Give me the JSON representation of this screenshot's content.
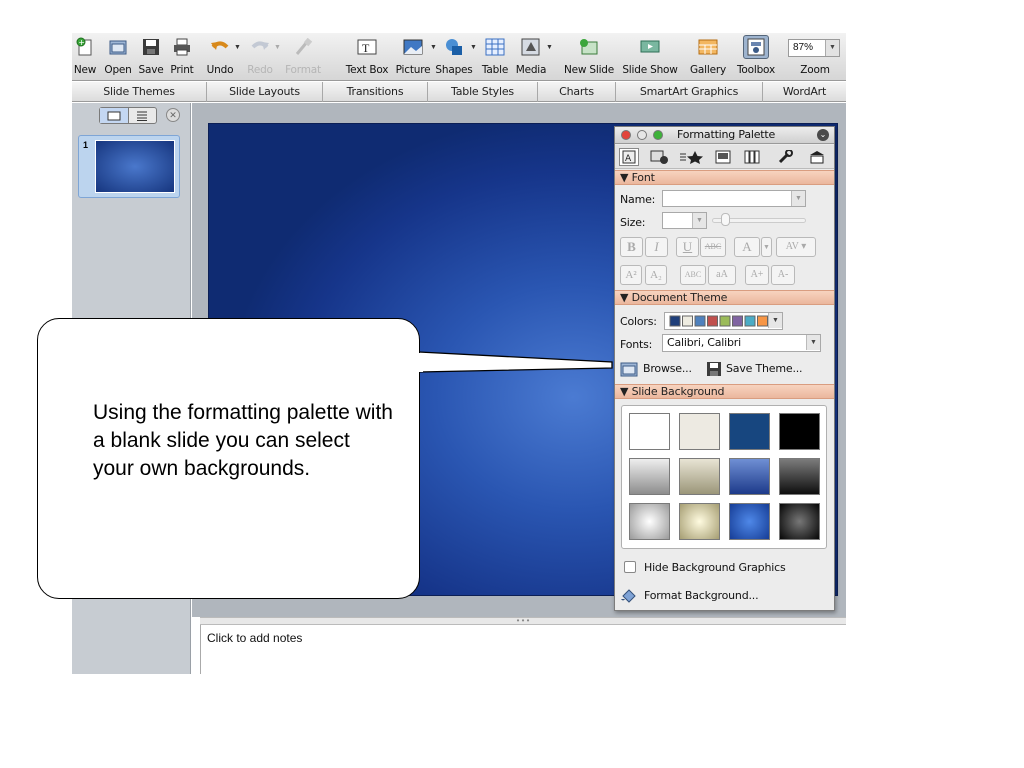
{
  "toolbar": {
    "buttons": [
      {
        "label": "New",
        "icon": "new-presentation-icon"
      },
      {
        "label": "Open",
        "icon": "open-icon"
      },
      {
        "label": "Save",
        "icon": "save-icon"
      },
      {
        "label": "Print",
        "icon": "print-icon"
      },
      {
        "label": "Undo",
        "icon": "undo-icon"
      },
      {
        "label": "Redo",
        "icon": "redo-icon",
        "disabled": true
      },
      {
        "label": "Format",
        "icon": "format-painter-icon",
        "disabled": true
      },
      {
        "label": "Text Box",
        "icon": "text-box-icon"
      },
      {
        "label": "Picture",
        "icon": "picture-icon"
      },
      {
        "label": "Shapes",
        "icon": "shapes-icon"
      },
      {
        "label": "Table",
        "icon": "table-icon"
      },
      {
        "label": "Media",
        "icon": "media-icon"
      },
      {
        "label": "New Slide",
        "icon": "new-slide-icon"
      },
      {
        "label": "Slide Show",
        "icon": "slide-show-icon"
      },
      {
        "label": "Gallery",
        "icon": "gallery-icon"
      },
      {
        "label": "Toolbox",
        "icon": "toolbox-icon"
      },
      {
        "label": "Zoom",
        "icon": "zoom-icon"
      }
    ],
    "zoom_value": "87%"
  },
  "ribbon": {
    "tabs": [
      "Slide Themes",
      "Slide Layouts",
      "Transitions",
      "Table Styles",
      "Charts",
      "SmartArt Graphics",
      "WordArt"
    ]
  },
  "slides_panel": {
    "slide_number": "1"
  },
  "notes": {
    "placeholder": "Click to add notes"
  },
  "palette": {
    "title": "Formatting Palette",
    "font_section": "Font",
    "name_label": "Name:",
    "size_label": "Size:",
    "theme_section": "Document Theme",
    "colors_label": "Colors:",
    "fonts_label": "Fonts:",
    "fonts_value": "Calibri, Calibri",
    "browse_label": "Browse...",
    "save_theme_label": "Save Theme...",
    "background_section": "Slide Background",
    "hide_graphics_label": "Hide Background Graphics",
    "format_background_label": "Format Background...",
    "theme_colors": [
      "#1f3f7a",
      "#eeece1",
      "#4f81bd",
      "#c0504d",
      "#9bbb59",
      "#8064a2",
      "#4bacc6",
      "#f79646"
    ],
    "background_swatches": [
      "white",
      "beige",
      "navy",
      "black",
      "grey-gradient",
      "khaki-gradient",
      "blue-gradient",
      "charcoal-gradient",
      "silver-radial",
      "cream-radial",
      "blue-radial",
      "black-radial"
    ]
  },
  "callout": {
    "text": "Using the formatting palette with a blank slide you can select your own backgrounds."
  }
}
